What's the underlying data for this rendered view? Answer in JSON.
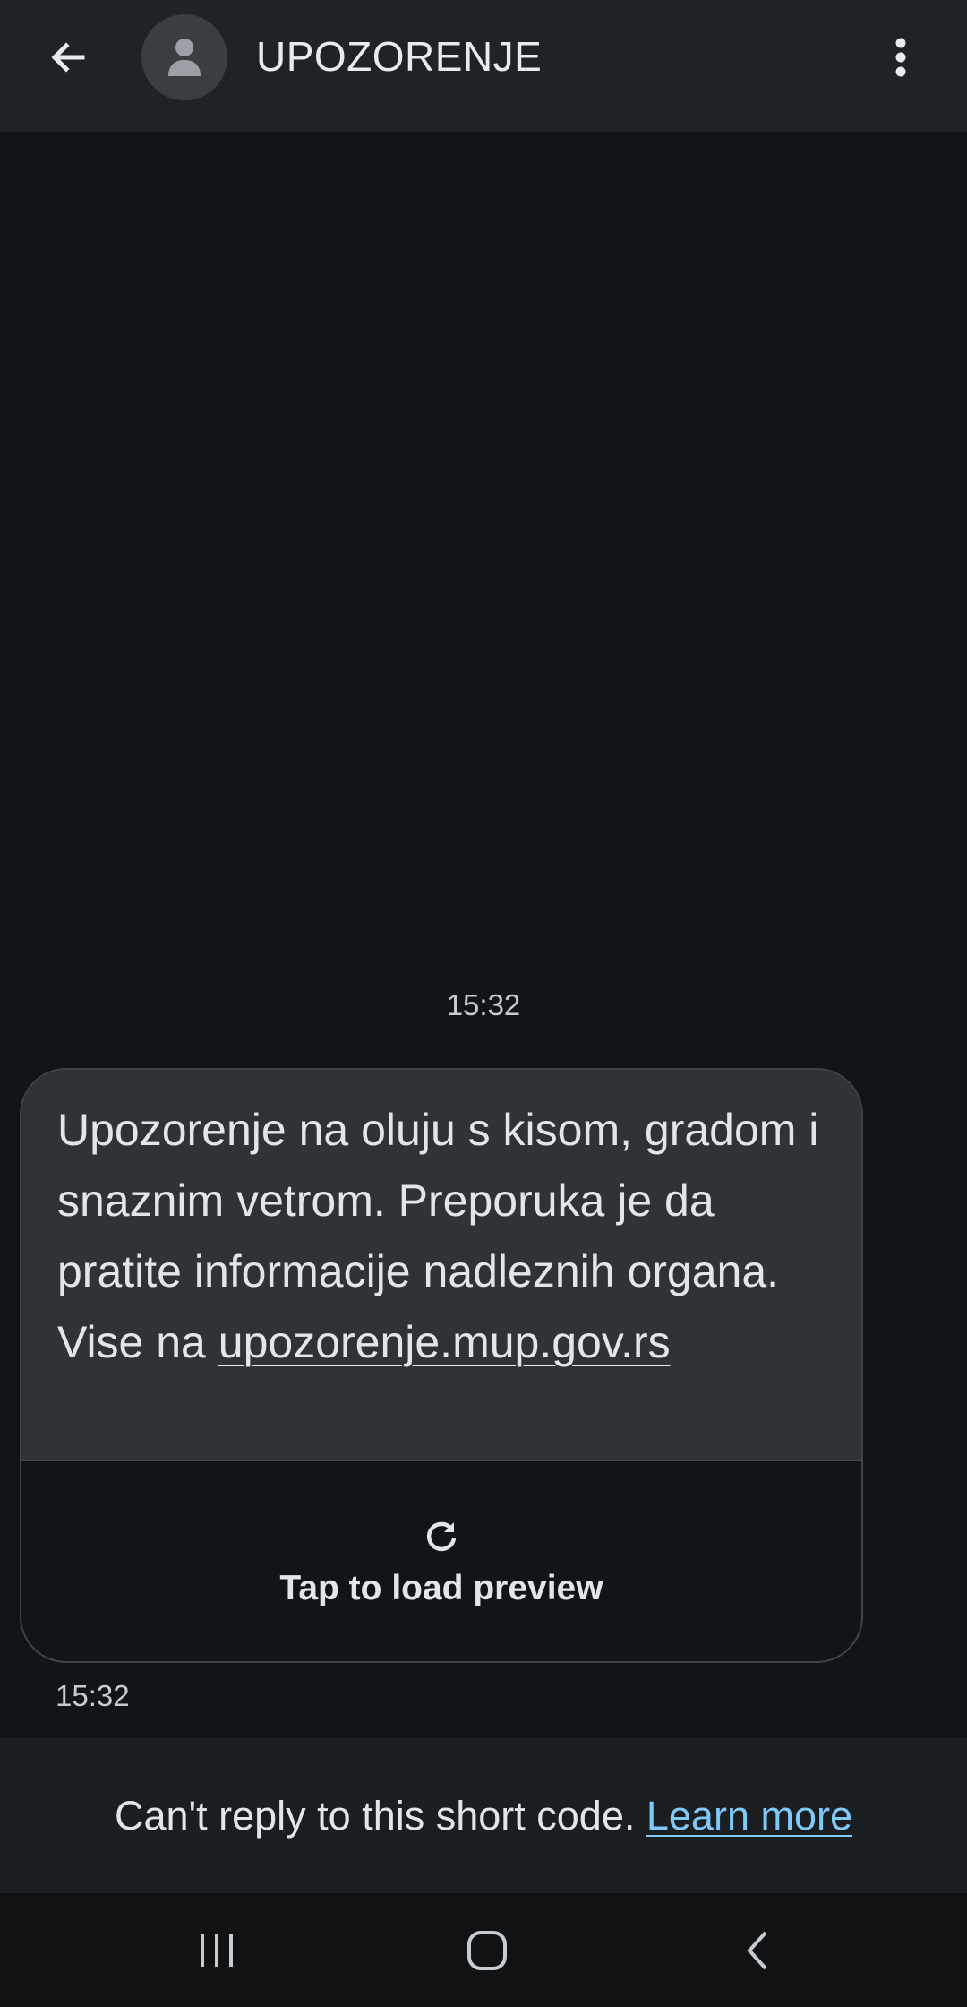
{
  "header": {
    "title": "UPOZORENJE",
    "back_icon": "arrow-back-icon",
    "avatar_icon": "person-icon",
    "menu_icon": "more-vert-icon"
  },
  "conversation": {
    "date_divider_time": "15:32",
    "message": {
      "text": "Upozorenje na oluju s kisom, gradom i snaznim vetrom. Preporuka je da pratite informacije nadleznih organa. Vise na ",
      "link": "upozorenje.mup.gov.rs",
      "preview_label": "Tap to load preview",
      "preview_icon": "refresh-icon",
      "time": "15:32"
    }
  },
  "footer": {
    "notice": "Can't reply to this short code. ",
    "learn_more": "Learn more",
    "link_color": "#7fc8f8"
  },
  "nav": {
    "recents_icon": "recents-icon",
    "home_icon": "home-icon",
    "back_icon": "back-chevron-icon"
  }
}
